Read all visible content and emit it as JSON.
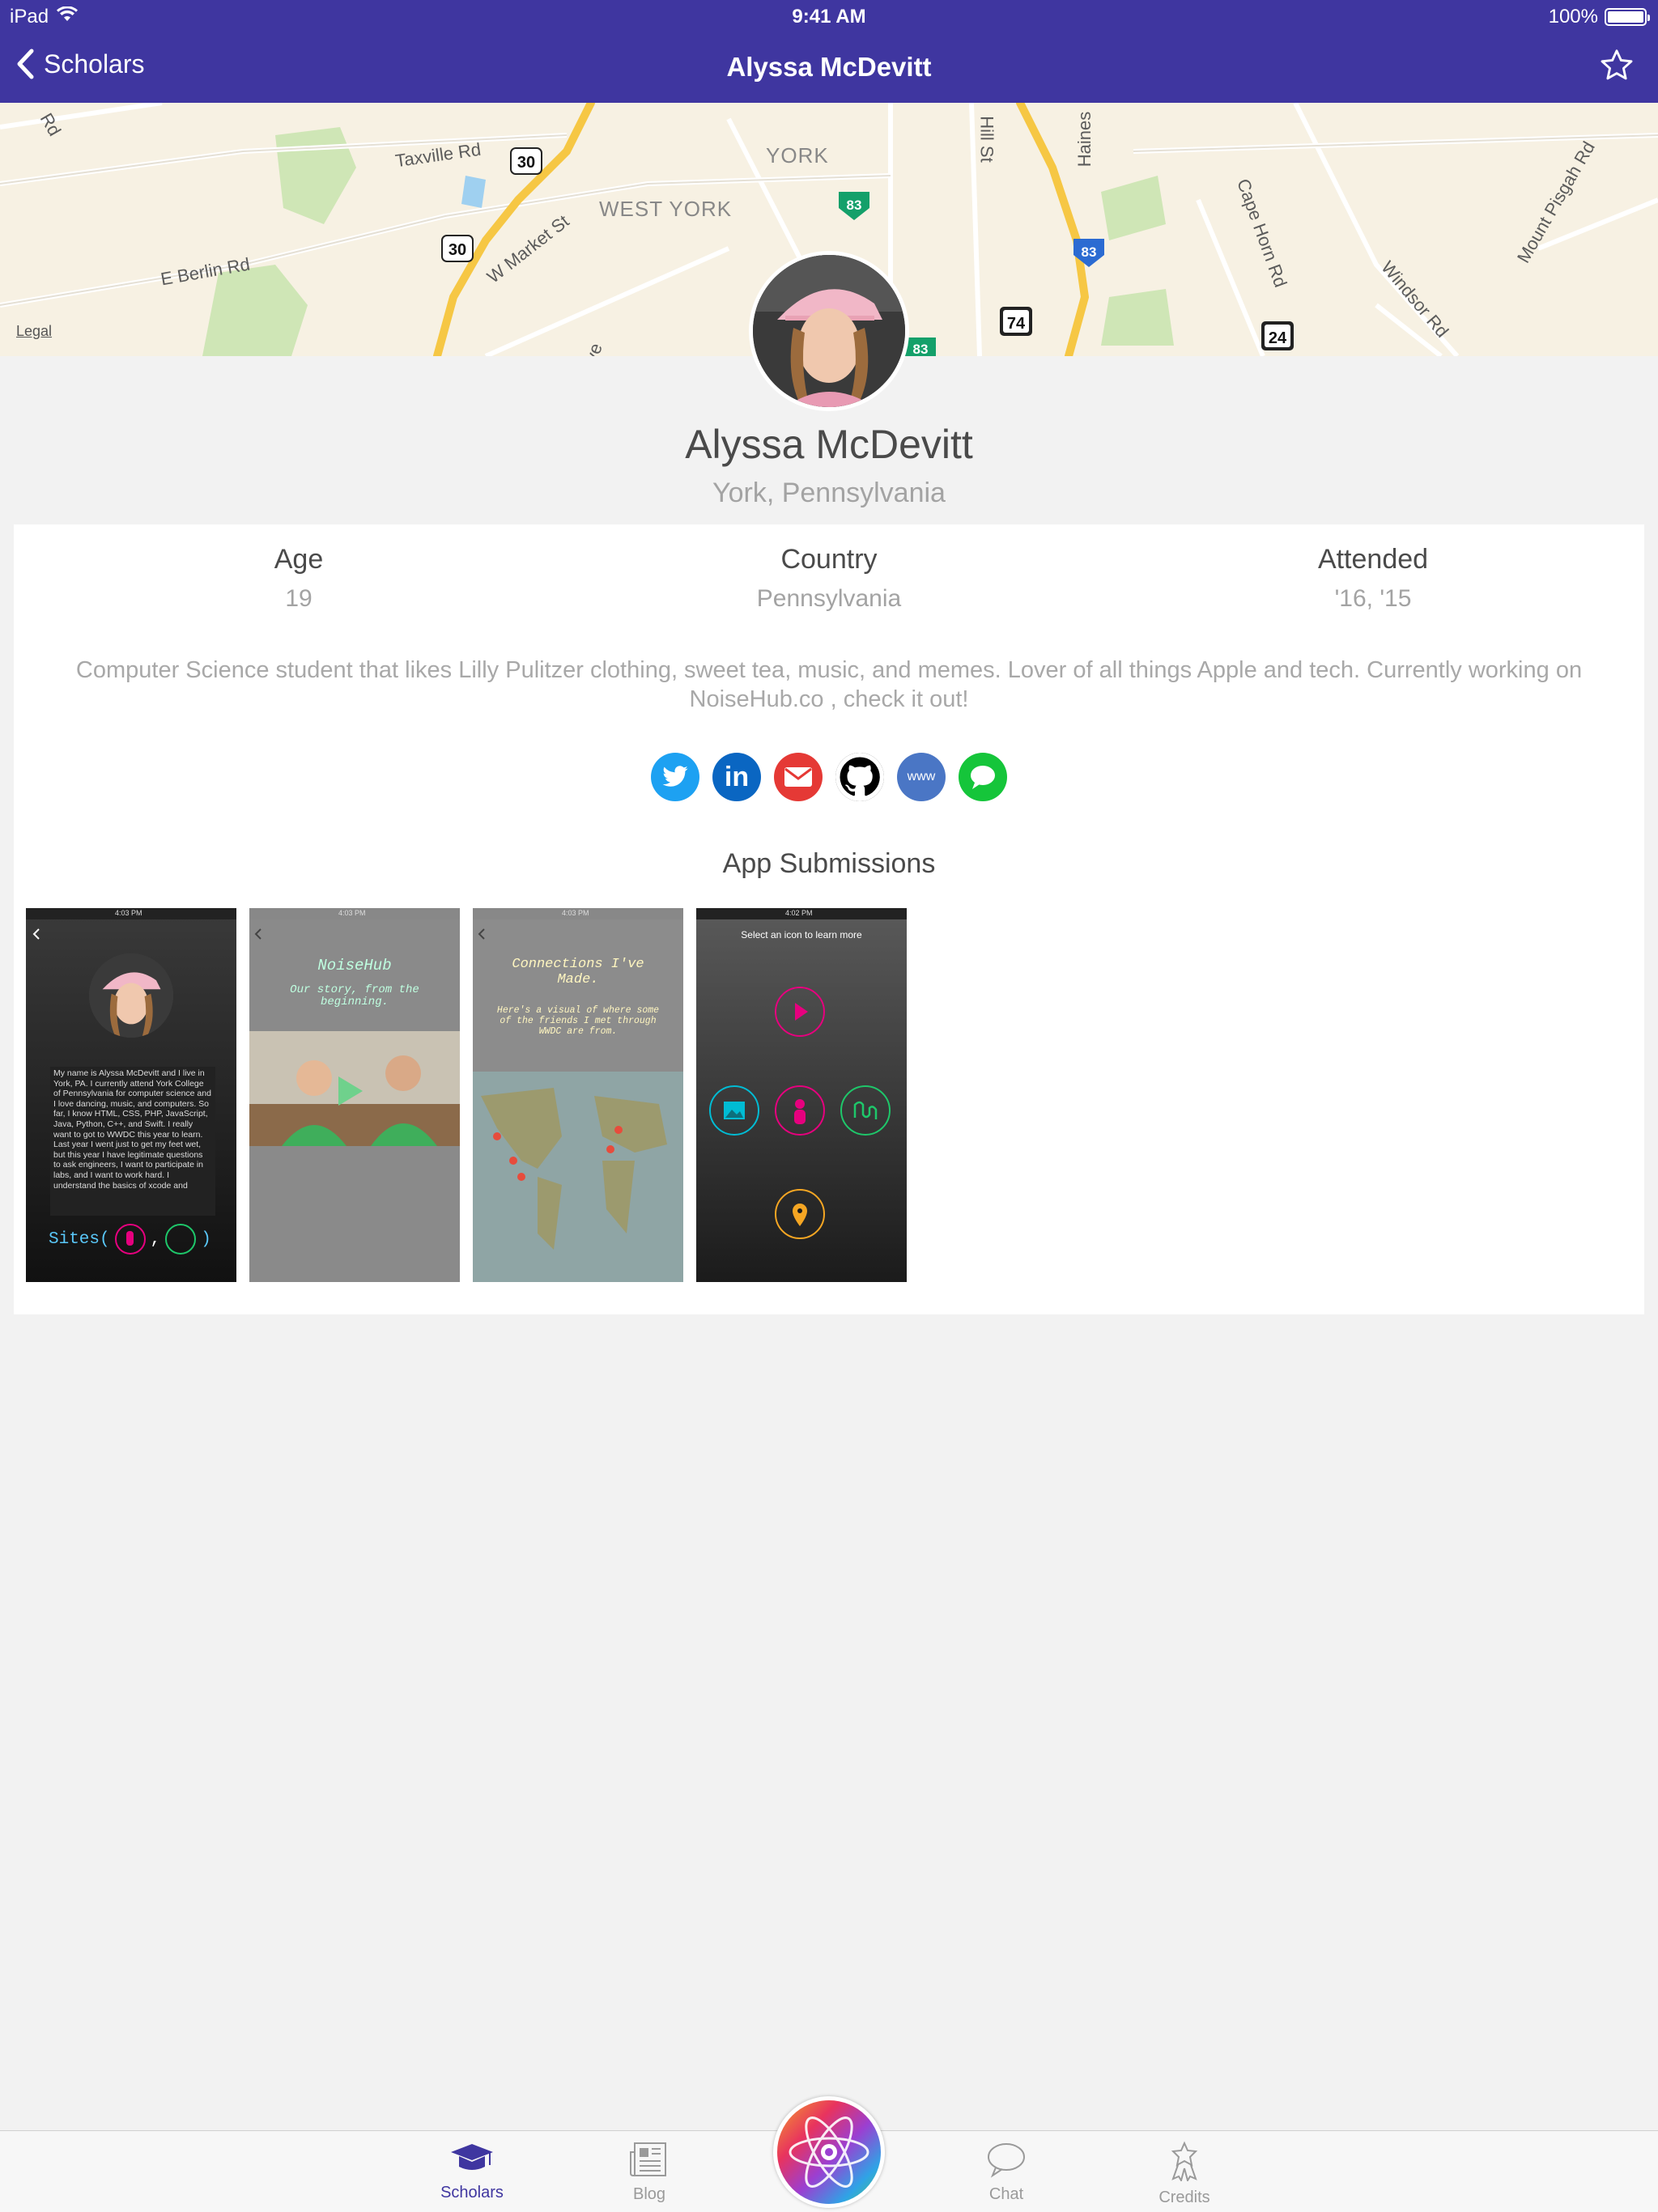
{
  "status_bar": {
    "device": "iPad",
    "time": "9:41 AM",
    "battery": "100%",
    "battery_level": 1.0
  },
  "nav": {
    "back_label": "Scholars",
    "title": "Alyssa McDevitt"
  },
  "map": {
    "roads": [
      "Taxville Rd",
      "E Berlin Rd",
      "W Market St",
      "Hill St",
      "Haines",
      "Cape Horn Rd",
      "Windsor Rd",
      "Mount Pisgah Rd",
      "Rd",
      "ve"
    ],
    "towns": [
      "YORK",
      "WEST YORK"
    ],
    "shields": [
      "30",
      "30",
      "83",
      "83",
      "83",
      "74",
      "24"
    ],
    "legal": "Legal"
  },
  "profile": {
    "name": "Alyssa McDevitt",
    "location": "York, Pennsylvania"
  },
  "stats": [
    {
      "label": "Age",
      "value": "19"
    },
    {
      "label": "Country",
      "value": "Pennsylvania"
    },
    {
      "label": "Attended",
      "value": "'16, '15"
    }
  ],
  "bio": "Computer Science student that likes Lilly Pulitzer clothing, sweet tea, music, and memes. Lover of all things Apple and tech. Currently working on NoiseHub.co , check it out!",
  "socials": [
    {
      "name": "twitter",
      "color": "#1da1f2",
      "text": ""
    },
    {
      "name": "linkedin",
      "color": "#0a66c2",
      "text": "in"
    },
    {
      "name": "email",
      "color": "#e53935",
      "text": ""
    },
    {
      "name": "github",
      "color": "#000000",
      "text": ""
    },
    {
      "name": "website",
      "color": "#4a76c5",
      "text": "www"
    },
    {
      "name": "imessage",
      "color": "#15c53a",
      "text": ""
    }
  ],
  "apps": {
    "title": "App Submissions",
    "screenshots": [
      {
        "time": "4:03 PM",
        "text": "My name is Alyssa McDevitt and I live in York, PA. I currently attend York College of Pennsylvania for computer science and I love dancing, music, and computers. So far, I know HTML, CSS, PHP, JavaScript, Java, Python, C++, and Swift. I really want to got to WWDC this year to learn. Last year I went just to get my feet wet, but this year I have legitimate questions to ask engineers, I want to participate in labs, and I want to work hard. I understand the basics of xcode and",
        "footer": "Sites(",
        "footer_sep": ",",
        "footer_end": ")"
      },
      {
        "time": "4:03 PM",
        "title": "NoiseHub",
        "subtitle": "Our story, from the beginning."
      },
      {
        "time": "4:03 PM",
        "title": "Connections I've Made.",
        "subtitle": "Here's a visual of where some of the friends I met through WWDC are from."
      },
      {
        "time": "4:02 PM",
        "header": "Select an icon to learn more"
      }
    ]
  },
  "tabs": [
    {
      "label": "Scholars",
      "icon": "graduation-cap-icon",
      "active": true
    },
    {
      "label": "Blog",
      "icon": "newspaper-icon",
      "active": false
    },
    {
      "label": "Chat",
      "icon": "chat-bubble-icon",
      "active": false
    },
    {
      "label": "Credits",
      "icon": "award-icon",
      "active": false
    }
  ],
  "colors": {
    "accent": "#3f36a0",
    "background": "#f2f2f2"
  }
}
